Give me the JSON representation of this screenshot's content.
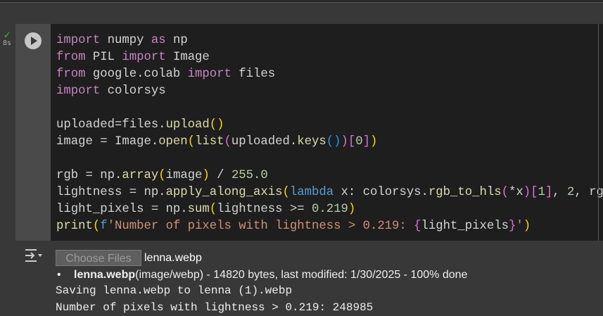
{
  "cell": {
    "status_icon": "check-icon",
    "duration": "8s",
    "code_lines": [
      [
        [
          "import",
          "kw"
        ],
        [
          " numpy ",
          ""
        ],
        [
          "as",
          "kw"
        ],
        [
          " np",
          ""
        ]
      ],
      [
        [
          "from",
          "kw"
        ],
        [
          " PIL ",
          ""
        ],
        [
          "import",
          "kw"
        ],
        [
          " Image",
          ""
        ]
      ],
      [
        [
          "from",
          "kw"
        ],
        [
          " google.colab ",
          ""
        ],
        [
          "import",
          "kw"
        ],
        [
          " files",
          ""
        ]
      ],
      [
        [
          "import",
          "kw"
        ],
        [
          " colorsys",
          ""
        ]
      ],
      [],
      [
        [
          "uploaded=files.",
          ""
        ],
        [
          "upload",
          "fn"
        ],
        [
          "(",
          "p1"
        ],
        [
          ")",
          "p1"
        ]
      ],
      [
        [
          "image = Image.",
          ""
        ],
        [
          "open",
          "fn"
        ],
        [
          "(",
          "p1"
        ],
        [
          "list",
          "fn"
        ],
        [
          "(",
          "p2"
        ],
        [
          "uploaded.",
          ""
        ],
        [
          "keys",
          "fn"
        ],
        [
          "()",
          "p3"
        ],
        [
          ")",
          "p2"
        ],
        [
          "[",
          "p2"
        ],
        [
          "0",
          "num"
        ],
        [
          "]",
          "p2"
        ],
        [
          ")",
          "p1"
        ]
      ],
      [],
      [
        [
          "rgb = np.",
          ""
        ],
        [
          "array",
          "fn"
        ],
        [
          "(",
          "p1"
        ],
        [
          "image",
          ""
        ],
        [
          ")",
          "p1"
        ],
        [
          " / ",
          ""
        ],
        [
          "255.0",
          "num"
        ]
      ],
      [
        [
          "lightness = np.",
          ""
        ],
        [
          "apply_along_axis",
          "fn"
        ],
        [
          "(",
          "p1"
        ],
        [
          "lambda",
          "blue"
        ],
        [
          " x: colorsys.",
          ""
        ],
        [
          "rgb_to_hls",
          "fn"
        ],
        [
          "(",
          "p2"
        ],
        [
          "*x",
          ""
        ],
        [
          ")",
          "p2"
        ],
        [
          "[",
          "p2"
        ],
        [
          "1",
          "num"
        ],
        [
          "]",
          "p2"
        ],
        [
          ", ",
          ""
        ],
        [
          "2",
          "num"
        ],
        [
          ", rgb",
          ""
        ],
        [
          ")",
          "p1"
        ]
      ],
      [
        [
          "light_pixels = np.",
          ""
        ],
        [
          "sum",
          "fn"
        ],
        [
          "(",
          "p1"
        ],
        [
          "lightness >= ",
          ""
        ],
        [
          "0.219",
          "num"
        ],
        [
          ")",
          "p1"
        ]
      ],
      [
        [
          "print",
          "fn"
        ],
        [
          "(",
          "p1"
        ],
        [
          "f",
          "blue"
        ],
        [
          "'Number of pixels with lightness > 0.219: ",
          "str"
        ],
        [
          "{",
          "p2"
        ],
        [
          "light_pixels",
          ""
        ],
        [
          "}",
          "p2"
        ],
        [
          "'",
          "str"
        ],
        [
          ")",
          "p1"
        ]
      ]
    ]
  },
  "output": {
    "choose_files_label": "Choose Files",
    "selected_file": "lenna.webp",
    "file_item_name": "lenna.webp",
    "file_item_details": "(image/webp) - 14820 bytes, last modified: 1/30/2025 - 100% done",
    "lines": [
      "Saving lenna.webp to lenna (1).webp",
      "Number of pixels with lightness > 0.219: 248985"
    ]
  }
}
